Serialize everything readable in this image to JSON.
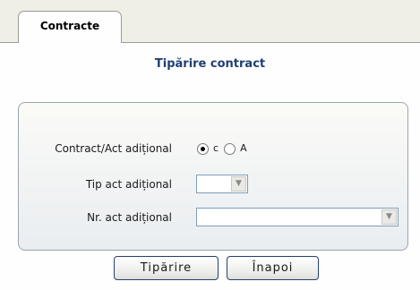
{
  "tab": {
    "label": "Contracte"
  },
  "page": {
    "title": "Tipărire contract"
  },
  "form": {
    "contract_label": "Contract/Act adițional",
    "radio_c": "c",
    "radio_a": "A",
    "selected_radio": "c",
    "tip_label": "Tip act adițional",
    "tip_value": "",
    "nr_label": "Nr. act adițional",
    "nr_value": ""
  },
  "buttons": {
    "print_label": "Tipărire",
    "back_label": "Înapoi"
  },
  "icons": {
    "dropdown": "chevron-down-icon"
  }
}
